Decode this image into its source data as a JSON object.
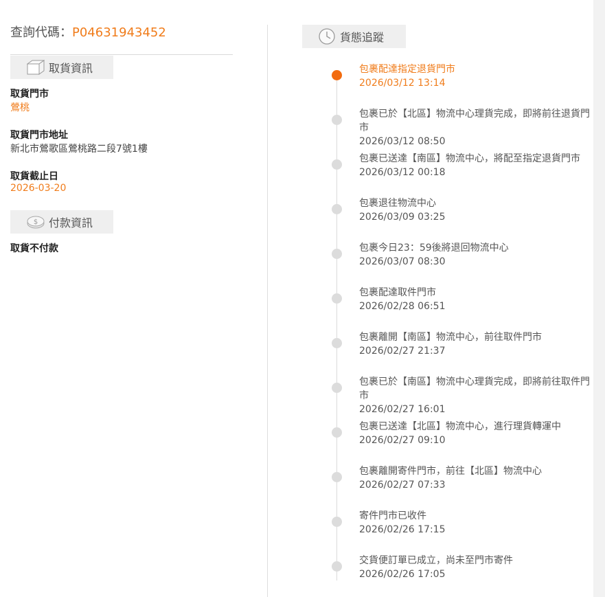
{
  "query": {
    "label": "查詢代碼：",
    "code": "P04631943452"
  },
  "pickup_section": {
    "title": "取貨資訊",
    "store_label": "取貨門市",
    "store_value": "鶯桃",
    "address_label": "取貨門市地址",
    "address_value": "新北市鶯歌區鶯桃路二段7號1樓",
    "deadline_label": "取貨截止日",
    "deadline_value": "2026-03-20"
  },
  "payment_section": {
    "title": "付款資訊",
    "method": "取貨不付款"
  },
  "status_section": {
    "title": "貨態追蹤"
  },
  "timeline": [
    {
      "text": "包裹配達指定退貨門市",
      "time": "2026/03/12 13:14",
      "active": true
    },
    {
      "text": "包裹已於【北區】物流中心理貨完成，即將前往退貨門市",
      "time": "2026/03/12 08:50"
    },
    {
      "text": "包裹已送達【南區】物流中心，將配至指定退貨門市",
      "time": "2026/03/12 00:18"
    },
    {
      "text": "包裹退往物流中心",
      "time": "2026/03/09 03:25"
    },
    {
      "text": "包裹今日23：59後將退回物流中心",
      "time": "2026/03/07 08:30"
    },
    {
      "text": "包裹配達取件門市",
      "time": "2026/02/28 06:51"
    },
    {
      "text": "包裹離開【南區】物流中心，前往取件門市",
      "time": "2026/02/27 21:37"
    },
    {
      "text": "包裹已於【南區】物流中心理貨完成，即將前往取件門市",
      "time": "2026/02/27 16:01"
    },
    {
      "text": "包裹已送達【北區】物流中心，進行理貨轉運中",
      "time": "2026/02/27 09:10"
    },
    {
      "text": "包裹離開寄件門市，前往【北區】物流中心",
      "time": "2026/02/27 07:33"
    },
    {
      "text": "寄件門市已收件",
      "time": "2026/02/26 17:15"
    },
    {
      "text": "交貨便訂單已成立，尚未至門市寄件",
      "time": "2026/02/26 17:05"
    }
  ],
  "colors": {
    "accent": "#f07c1b",
    "active_dot": "#f26b0f",
    "inactive_dot": "#dcdcdc"
  },
  "icons": {
    "pickup": "box-icon",
    "payment": "coin-icon",
    "status": "clock-icon"
  }
}
